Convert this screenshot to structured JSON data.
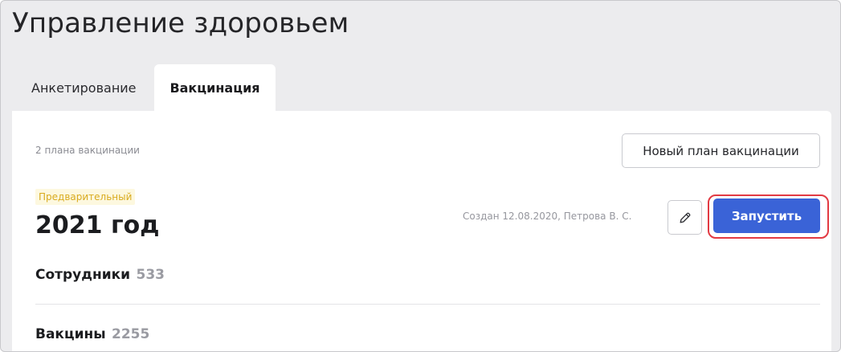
{
  "header": {
    "title": "Управление здоровьем"
  },
  "tabs": [
    {
      "label": "Анкетирование",
      "active": false
    },
    {
      "label": "Вакцинация",
      "active": true
    }
  ],
  "panel": {
    "plans_count": "2 плана вакцинации",
    "new_plan_label": "Новый план вакцинации",
    "plan": {
      "status": "Предварительный",
      "title": "2021 год",
      "created": "Создан 12.08.2020, Петрова В. С.",
      "edit_icon": "pencil-icon",
      "start_label": "Запустить"
    },
    "sections": {
      "employees": {
        "label": "Сотрудники",
        "count": "533"
      },
      "vaccines": {
        "label": "Вакцины",
        "count": "2255"
      }
    }
  },
  "colors": {
    "accent": "#3a63d7",
    "highlight": "#e23a43",
    "status_text": "#d9ab1f",
    "status_bg": "#fdf8df",
    "page_bg": "#ececee"
  }
}
